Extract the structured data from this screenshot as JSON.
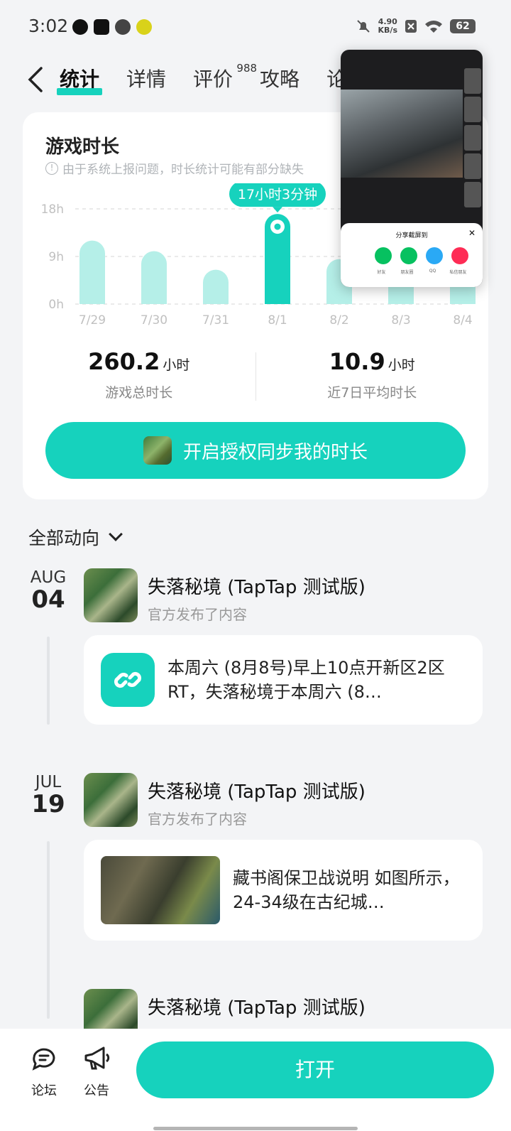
{
  "status_bar": {
    "time": "3:02",
    "net_speed_value": "4.90",
    "net_speed_unit": "KB/s",
    "battery": "62"
  },
  "tabs": [
    {
      "label": "统计",
      "active": true
    },
    {
      "label": "详情"
    },
    {
      "label": "评价",
      "badge": "988"
    },
    {
      "label": "攻略"
    },
    {
      "label": "论"
    }
  ],
  "stats_card": {
    "title": "游戏时长",
    "note": "由于系统上报问题，时长统计可能有部分缺失",
    "tooltip": "17小时3分钟",
    "total_value": "260.2",
    "total_unit": "小时",
    "total_label": "游戏总时长",
    "avg_value": "10.9",
    "avg_unit": "小时",
    "avg_label": "近7日平均时长",
    "sync_button": "开启授权同步我的时长"
  },
  "chart_data": {
    "type": "bar",
    "categories": [
      "7/29",
      "7/30",
      "7/31",
      "8/1",
      "8/2",
      "8/3",
      "8/4"
    ],
    "values": [
      12,
      10,
      6.5,
      17.05,
      8.5,
      7,
      9
    ],
    "y_ticks": [
      "18h",
      "9h",
      "0h"
    ],
    "ylim": [
      0,
      18
    ],
    "highlight_index": 3,
    "colors": {
      "bar": "#b5efe8",
      "highlight": "#16d2bd"
    }
  },
  "share_overlay": {
    "title": "分享截屏到",
    "close": "✕",
    "targets": [
      "好友",
      "朋友圈",
      "QQ",
      "私信朋友"
    ],
    "colors": [
      "#07c160",
      "#07c160",
      "#2aa9f5",
      "#fe2c55"
    ]
  },
  "feed": {
    "header": "全部动向",
    "entries": [
      {
        "month": "AUG",
        "day": "04",
        "title": "失落秘境 (TapTap 测试版)",
        "subtitle": "官方发布了内容",
        "text": "本周六 (8月8号)早上10点开新区2区 RT，失落秘境于本周六 (8…"
      },
      {
        "month": "JUL",
        "day": "19",
        "title": "失落秘境 (TapTap 测试版)",
        "subtitle": "官方发布了内容",
        "text": "藏书阁保卫战说明 如图所示，24-34级在古纪城…"
      },
      {
        "title": "失落秘境 (TapTap 测试版)"
      }
    ]
  },
  "bottom_bar": {
    "forum": "论坛",
    "notice": "公告",
    "open": "打开"
  }
}
